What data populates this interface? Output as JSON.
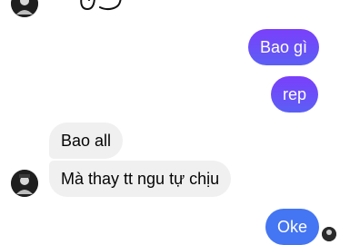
{
  "theme": {
    "accent": "#6a3df5",
    "accent_blue": "#4475f2",
    "incoming_bg": "#f0f0f0",
    "avatar_bg": "#1f1f1f"
  },
  "icons": {
    "sticker": "doodle-sticker",
    "avatar": "user-avatar",
    "read_receipt": "seen-avatar-icon"
  },
  "messages": [
    {
      "direction": "outgoing",
      "text": "Bao gì"
    },
    {
      "direction": "outgoing",
      "text": "rep"
    },
    {
      "direction": "incoming",
      "text": "Bao all"
    },
    {
      "direction": "incoming",
      "text": "Mà thay tt ngu tự chịu"
    },
    {
      "direction": "outgoing",
      "text": "Oke"
    }
  ]
}
